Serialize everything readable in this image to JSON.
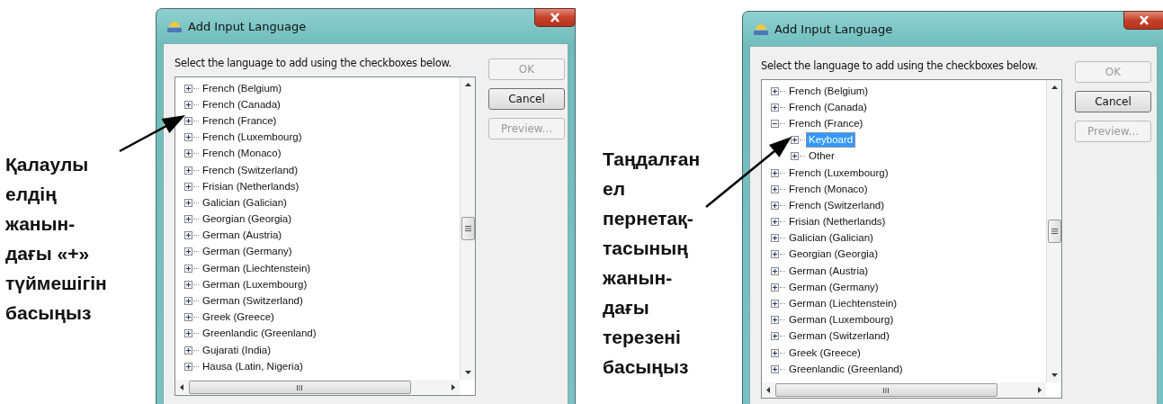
{
  "captions": [
    {
      "lines": [
        "Қалаулы",
        "елдің",
        "жанын-",
        "дағы «+»",
        "түймешігін",
        "басыңыз"
      ]
    },
    {
      "lines": [
        "Таңдалған",
        "ел",
        "пернетақ-",
        "тасының",
        "жанын-",
        "дағы",
        "терезені",
        "басыңыз"
      ]
    }
  ],
  "dialogs": [
    {
      "title": "Add Input Language",
      "instruction": "Select the language to add using the checkboxes below.",
      "tree": [
        {
          "label": "French (Belgium)",
          "expanded": false,
          "selected": false
        },
        {
          "label": "French (Canada)",
          "expanded": false,
          "selected": false
        },
        {
          "label": "French (France)",
          "expanded": false,
          "selected": false
        },
        {
          "label": "French (Luxembourg)",
          "expanded": false,
          "selected": false
        },
        {
          "label": "French (Monaco)",
          "expanded": false,
          "selected": false
        },
        {
          "label": "French (Switzerland)",
          "expanded": false,
          "selected": false
        },
        {
          "label": "Frisian (Netherlands)",
          "expanded": false,
          "selected": false
        },
        {
          "label": "Galician (Galician)",
          "expanded": false,
          "selected": false
        },
        {
          "label": "Georgian (Georgia)",
          "expanded": false,
          "selected": false
        },
        {
          "label": "German (Austria)",
          "expanded": false,
          "selected": false
        },
        {
          "label": "German (Germany)",
          "expanded": false,
          "selected": false
        },
        {
          "label": "German (Liechtenstein)",
          "expanded": false,
          "selected": false
        },
        {
          "label": "German (Luxembourg)",
          "expanded": false,
          "selected": false
        },
        {
          "label": "German (Switzerland)",
          "expanded": false,
          "selected": false
        },
        {
          "label": "Greek (Greece)",
          "expanded": false,
          "selected": false
        },
        {
          "label": "Greenlandic (Greenland)",
          "expanded": false,
          "selected": false
        },
        {
          "label": "Gujarati (India)",
          "expanded": false,
          "selected": false
        },
        {
          "label": "Hausa (Latin, Nigeria)",
          "expanded": false,
          "selected": false
        }
      ],
      "buttons": [
        {
          "label": "OK",
          "disabled": true
        },
        {
          "label": "Cancel",
          "disabled": false
        },
        {
          "label": "Preview...",
          "disabled": true
        }
      ]
    },
    {
      "title": "Add Input Language",
      "instruction": "Select the language to add using the checkboxes below.",
      "tree": [
        {
          "label": "French (Belgium)",
          "expanded": false,
          "selected": false
        },
        {
          "label": "French (Canada)",
          "expanded": false,
          "selected": false
        },
        {
          "label": "French (France)",
          "expanded": true,
          "selected": false,
          "children": [
            {
              "label": "Keyboard",
              "expanded": false,
              "selected": true
            },
            {
              "label": "Other",
              "expanded": false,
              "selected": false
            }
          ]
        },
        {
          "label": "French (Luxembourg)",
          "expanded": false,
          "selected": false
        },
        {
          "label": "French (Monaco)",
          "expanded": false,
          "selected": false
        },
        {
          "label": "French (Switzerland)",
          "expanded": false,
          "selected": false
        },
        {
          "label": "Frisian (Netherlands)",
          "expanded": false,
          "selected": false
        },
        {
          "label": "Galician (Galician)",
          "expanded": false,
          "selected": false
        },
        {
          "label": "Georgian (Georgia)",
          "expanded": false,
          "selected": false
        },
        {
          "label": "German (Austria)",
          "expanded": false,
          "selected": false
        },
        {
          "label": "German (Germany)",
          "expanded": false,
          "selected": false
        },
        {
          "label": "German (Liechtenstein)",
          "expanded": false,
          "selected": false
        },
        {
          "label": "German (Luxembourg)",
          "expanded": false,
          "selected": false
        },
        {
          "label": "German (Switzerland)",
          "expanded": false,
          "selected": false
        },
        {
          "label": "Greek (Greece)",
          "expanded": false,
          "selected": false
        },
        {
          "label": "Greenlandic (Greenland)",
          "expanded": false,
          "selected": false
        }
      ],
      "buttons": [
        {
          "label": "OK",
          "disabled": true
        },
        {
          "label": "Cancel",
          "disabled": false
        },
        {
          "label": "Preview...",
          "disabled": true
        }
      ]
    }
  ]
}
